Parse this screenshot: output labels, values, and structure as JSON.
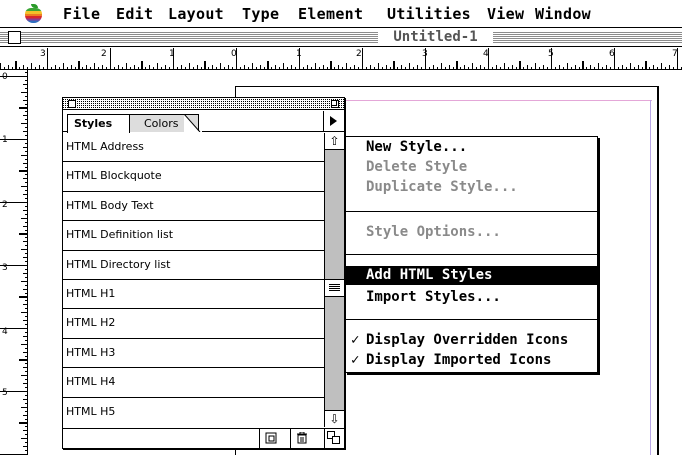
{
  "menubar": {
    "items": [
      "File",
      "Edit",
      "Layout",
      "Type",
      "Element",
      "Utilities",
      "View",
      "Window"
    ]
  },
  "document": {
    "title": "Untitled-1"
  },
  "ruler": {
    "horizontal_labels": [
      "3",
      "2",
      "1",
      "0",
      "1",
      "2",
      "3",
      "4",
      "5",
      "6",
      "7"
    ],
    "vertical_labels": [
      "0",
      "1",
      "2",
      "3",
      "4",
      "5"
    ]
  },
  "palette": {
    "tabs": [
      "Styles",
      "Colors"
    ],
    "active_tab": "Styles",
    "styles": [
      "HTML Address",
      "HTML Blockquote",
      "HTML Body Text",
      "HTML Definition list",
      "HTML Directory list",
      "HTML H1",
      "HTML H2",
      "HTML H3",
      "HTML H4",
      "HTML H5"
    ]
  },
  "popup_menu": {
    "items": [
      {
        "label": "New Style...",
        "enabled": true,
        "checked": false,
        "selected": false
      },
      {
        "label": "Delete Style",
        "enabled": false,
        "checked": false,
        "selected": false
      },
      {
        "label": "Duplicate Style...",
        "enabled": false,
        "checked": false,
        "selected": false
      },
      {
        "label": "Style Options...",
        "enabled": false,
        "checked": false,
        "selected": false
      },
      {
        "label": "Add HTML Styles",
        "enabled": true,
        "checked": false,
        "selected": true
      },
      {
        "label": "Import Styles...",
        "enabled": true,
        "checked": false,
        "selected": false
      },
      {
        "label": "Display Overridden Icons",
        "enabled": true,
        "checked": true,
        "selected": false
      },
      {
        "label": "Display Imported Icons",
        "enabled": true,
        "checked": true,
        "selected": false
      }
    ],
    "check_glyph": "✓"
  },
  "colors": {
    "margin_guide_vertical": "#b9a6e6",
    "margin_guide_horizontal": "#e4a7d8",
    "disabled_text": "#8a8a8a"
  }
}
